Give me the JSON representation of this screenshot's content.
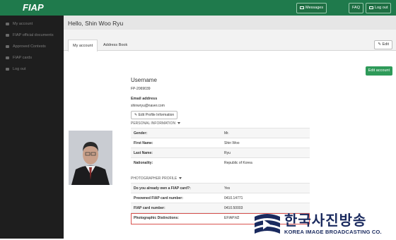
{
  "app": {
    "logo": "FIAP"
  },
  "sidebar": {
    "items": [
      {
        "label": "My account",
        "icon": "user-icon"
      },
      {
        "label": "FIAP official documents",
        "icon": "folder-icon"
      },
      {
        "label": "Approved Contests",
        "icon": "folder-icon"
      },
      {
        "label": "FIAP cards",
        "icon": "card-icon"
      },
      {
        "label": "Log out",
        "icon": "logout-icon"
      }
    ]
  },
  "topbar": {
    "messages": "Messages",
    "faq": "FAQ",
    "logout": "Log out"
  },
  "header": {
    "greeting": "Hello, Shin Woo Ryu"
  },
  "tabs": [
    {
      "label": "My account"
    },
    {
      "label": "Address Book"
    }
  ],
  "actions": {
    "edit": "Edit",
    "edit_account": "Edit account",
    "edit_profile": "Edit Profile Information"
  },
  "account": {
    "username_label": "Username",
    "username": "FP-2069039",
    "email_label": "Email address",
    "email": "shinwryu@naver.com"
  },
  "personal": {
    "title": "PERSONAL INFORMATION",
    "rows": [
      {
        "key": "Gender:",
        "value": "Mr."
      },
      {
        "key": "First Name:",
        "value": "Shin Woo"
      },
      {
        "key": "Last Name:",
        "value": "Ryu"
      },
      {
        "key": "Nationality:",
        "value": "Republic of Korea"
      }
    ]
  },
  "photographer": {
    "title": "PHOTOGRAPHER PROFILE",
    "rows": [
      {
        "key": "Do you already own a FIAP card?:",
        "value": "Yes"
      },
      {
        "key": "Preowned FIAP card number:",
        "value": "0410.14771"
      },
      {
        "key": "FIAP card number:",
        "value": "0410.50003"
      },
      {
        "key": "Photographic Distinctions:",
        "value": "EFIAP/d2"
      }
    ]
  },
  "watermark": {
    "korean": "한국사진방송",
    "english": "KOREA IMAGE BROADCASTING CO."
  },
  "colors": {
    "brand": "#1f7a4c",
    "sidebar": "#1e1e1e",
    "highlight": "#d9534f"
  }
}
